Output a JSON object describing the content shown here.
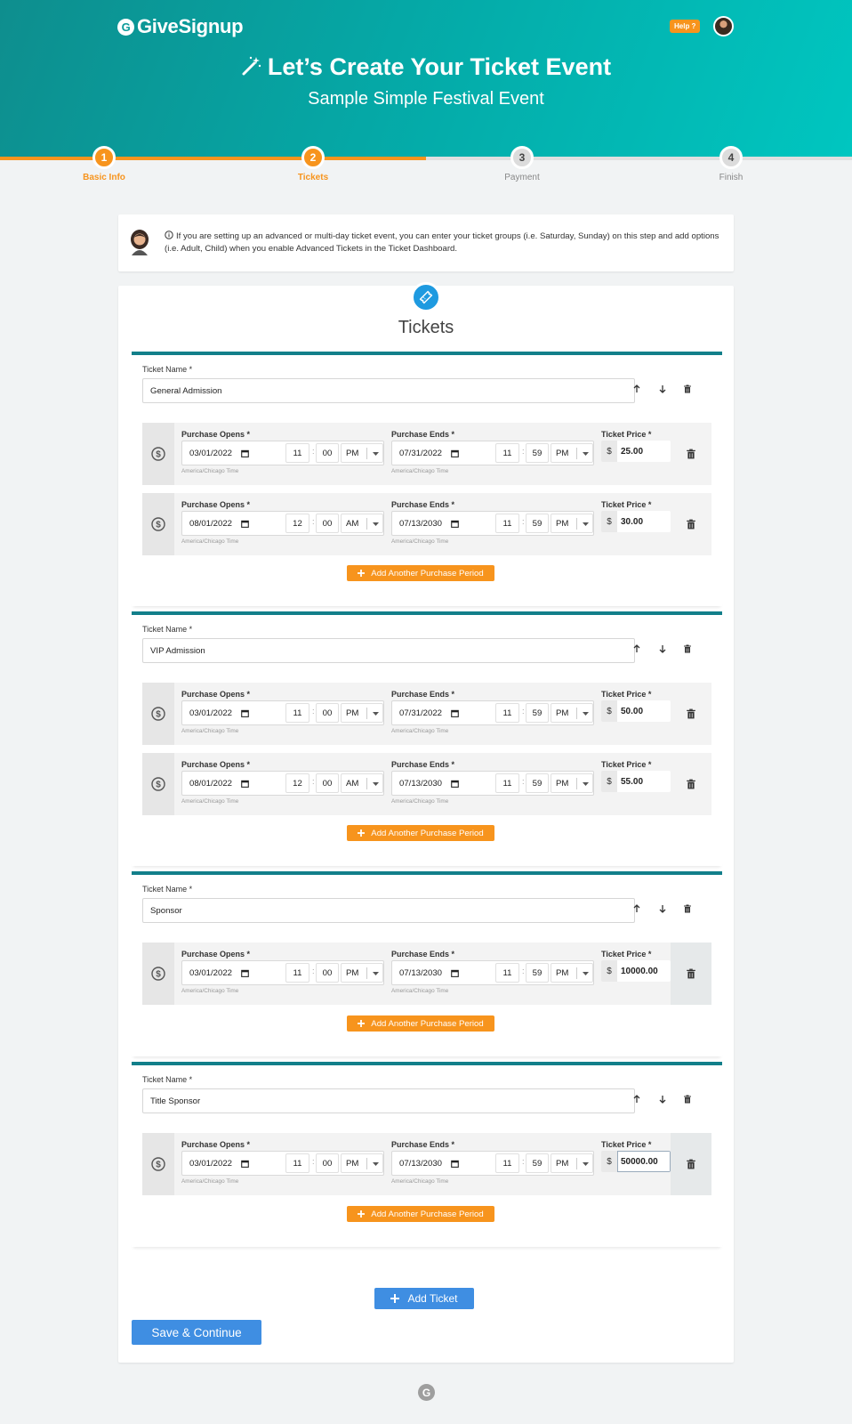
{
  "header": {
    "logo_mark": "G",
    "logo_text": "GiveSignup",
    "help_label": "Help ?",
    "title": "Let’s Create Your Ticket Event",
    "subtitle": "Sample Simple Festival Event"
  },
  "steps": [
    {
      "num": "1",
      "label": "Basic Info",
      "state": "done"
    },
    {
      "num": "2",
      "label": "Tickets",
      "state": "active"
    },
    {
      "num": "3",
      "label": "Payment",
      "state": "pending"
    },
    {
      "num": "4",
      "label": "Finish",
      "state": "pending"
    }
  ],
  "info_text": "If you are setting up an advanced or multi-day ticket event, you can enter your ticket groups (i.e. Saturday, Sunday) on this step and add options (i.e. Adult, Child) when you enable Advanced Tickets in the Ticket Dashboard.",
  "section_title": "Tickets",
  "labels": {
    "ticket_name": "Ticket Name *",
    "purchase_opens": "Purchase Opens *",
    "purchase_ends": "Purchase Ends *",
    "ticket_price": "Ticket Price *",
    "timezone": "America/Chicago Time",
    "currency": "$",
    "colon": ":",
    "add_period": "Add Another Purchase Period",
    "add_ticket": "Add Ticket",
    "save": "Save & Continue"
  },
  "tickets": [
    {
      "name": "General Admission",
      "periods": [
        {
          "open_date": "03/01/2022",
          "open_h": "11",
          "open_m": "00",
          "open_ap": "PM",
          "end_date": "07/31/2022",
          "end_h": "11",
          "end_m": "59",
          "end_ap": "PM",
          "price": "25.00"
        },
        {
          "open_date": "08/01/2022",
          "open_h": "12",
          "open_m": "00",
          "open_ap": "AM",
          "end_date": "07/13/2030",
          "end_h": "11",
          "end_m": "59",
          "end_ap": "PM",
          "price": "30.00"
        }
      ]
    },
    {
      "name": "VIP Admission",
      "periods": [
        {
          "open_date": "03/01/2022",
          "open_h": "11",
          "open_m": "00",
          "open_ap": "PM",
          "end_date": "07/31/2022",
          "end_h": "11",
          "end_m": "59",
          "end_ap": "PM",
          "price": "50.00"
        },
        {
          "open_date": "08/01/2022",
          "open_h": "12",
          "open_m": "00",
          "open_ap": "AM",
          "end_date": "07/13/2030",
          "end_h": "11",
          "end_m": "59",
          "end_ap": "PM",
          "price": "55.00"
        }
      ]
    },
    {
      "name": "Sponsor",
      "periods": [
        {
          "open_date": "03/01/2022",
          "open_h": "11",
          "open_m": "00",
          "open_ap": "PM",
          "end_date": "07/13/2030",
          "end_h": "11",
          "end_m": "59",
          "end_ap": "PM",
          "price": "10000.00"
        }
      ]
    },
    {
      "name": "Title Sponsor",
      "periods": [
        {
          "open_date": "03/01/2022",
          "open_h": "11",
          "open_m": "00",
          "open_ap": "PM",
          "end_date": "07/13/2030",
          "end_h": "11",
          "end_m": "59",
          "end_ap": "PM",
          "price": "50000.00"
        }
      ]
    }
  ],
  "footer_mark": "G",
  "colors": {
    "brand_teal": "#0b9a99",
    "accent_orange": "#f7941d",
    "primary_blue": "#3f8ee2",
    "group_border": "#127f8a"
  }
}
